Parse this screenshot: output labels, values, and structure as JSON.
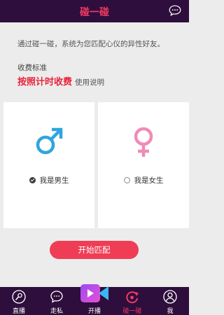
{
  "header": {
    "title": "碰一碰",
    "chat_icon": "chat-bubble-icon"
  },
  "intro": {
    "description": "通过碰一碰，系统为您匹配心仪的异性好友。",
    "fee_label": "收费标准",
    "fee_mode": "按照计时收费",
    "fee_link": "使用说明"
  },
  "options": {
    "male": {
      "label": "我是男生",
      "selected": true,
      "icon": "male-symbol-icon"
    },
    "female": {
      "label": "我是女生",
      "selected": false,
      "icon": "female-symbol-icon"
    }
  },
  "start_button": "开始匹配",
  "tabs": [
    {
      "label": "直播",
      "icon": "microphone-icon",
      "active": false
    },
    {
      "label": "走私",
      "icon": "chat-icon",
      "active": false
    },
    {
      "label": "开播",
      "icon": "video-camera-icon",
      "active": false
    },
    {
      "label": "碰一碰",
      "icon": "bump-icon",
      "active": true
    },
    {
      "label": "我",
      "icon": "user-icon",
      "active": false
    }
  ],
  "colors": {
    "header_bg": "#2e0e3c",
    "accent_red": "#e8233a",
    "male_blue": "#2fa5de",
    "female_pink": "#f08bb7",
    "button_red": "#ef3d55"
  }
}
